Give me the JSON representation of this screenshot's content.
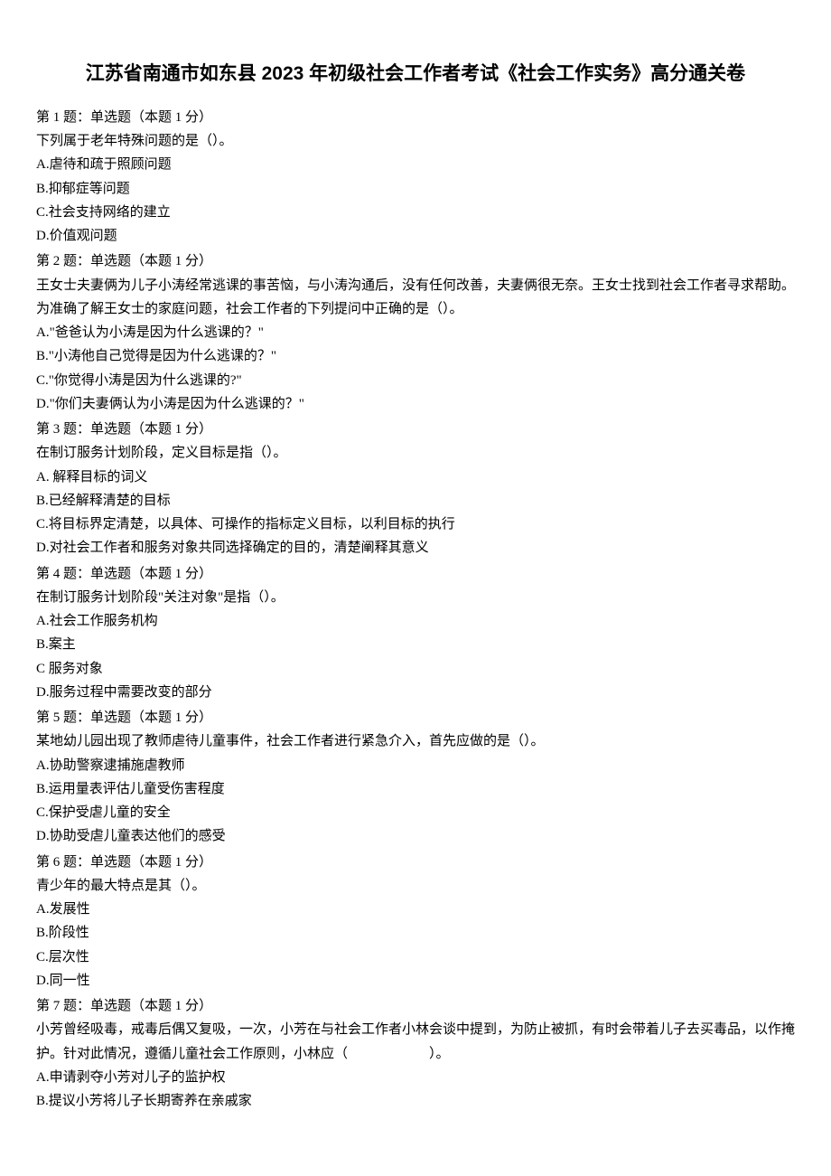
{
  "title": "江苏省南通市如东县 2023 年初级社会工作者考试《社会工作实务》高分通关卷",
  "questions": [
    {
      "header": "第 1 题：单选题（本题 1 分）",
      "stem": "下列属于老年特殊问题的是（）。",
      "options": [
        "A.虐待和疏于照顾问题",
        "B.抑郁症等问题",
        "C.社会支持网络的建立",
        "D.价值观问题"
      ]
    },
    {
      "header": "第 2 题：单选题（本题 1 分）",
      "stem": "王女士夫妻俩为儿子小涛经常逃课的事苦恼，与小涛沟通后，没有任何改善，夫妻俩很无奈。王女士找到社会工作者寻求帮助。为准确了解王女士的家庭问题，社会工作者的下列提问中正确的是（）。",
      "options": [
        "A.\"爸爸认为小涛是因为什么逃课的？\"",
        "B.\"小涛他自己觉得是因为什么逃课的？\"",
        "C.\"你觉得小涛是因为什么逃课的?\"",
        "D.\"你们夫妻俩认为小涛是因为什么逃课的？\""
      ]
    },
    {
      "header": "第 3 题：单选题（本题 1 分）",
      "stem": "在制订服务计划阶段，定义目标是指（）。",
      "options": [
        "A. 解释目标的词义",
        "B.已经解释清楚的目标",
        "C.将目标界定清楚，以具体、可操作的指标定义目标，以利目标的执行",
        "D.对社会工作者和服务对象共同选择确定的目的，清楚阐释其意义"
      ]
    },
    {
      "header": "第 4 题：单选题（本题 1 分）",
      "stem": "在制订服务计划阶段\"关注对象\"是指（）。",
      "options": [
        "A.社会工作服务机构",
        "B.案主",
        "C 服务对象",
        "D.服务过程中需要改变的部分"
      ]
    },
    {
      "header": "第 5 题：单选题（本题 1 分）",
      "stem": "某地幼儿园出现了教师虐待儿童事件，社会工作者进行紧急介入，首先应做的是（）。",
      "options": [
        "A.协助警察逮捕施虐教师",
        "B.运用量表评估儿童受伤害程度",
        "C.保护受虐儿童的安全",
        "D.协助受虐儿童表达他们的感受"
      ]
    },
    {
      "header": "第 6 题：单选题（本题 1 分）",
      "stem": "青少年的最大特点是其（）。",
      "options": [
        "A.发展性",
        "B.阶段性",
        "C.层次性",
        "D.同一性"
      ]
    },
    {
      "header": "第 7 题：单选题（本题 1 分）",
      "stem": "小芳曾经吸毒，戒毒后偶又复吸，一次，小芳在与社会工作者小林会谈中提到，为防止被抓，有时会带着儿子去买毒品，以作掩护。针对此情况，遵循儿童社会工作原则，小林应（　　　　　　）。",
      "options": [
        "A.申请剥夺小芳对儿子的监护权",
        "B.提议小芳将儿子长期寄养在亲戚家"
      ]
    }
  ]
}
